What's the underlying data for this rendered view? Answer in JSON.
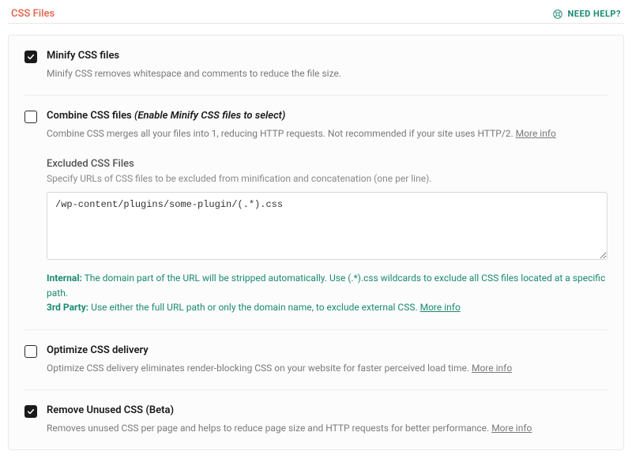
{
  "header": {
    "title": "CSS Files",
    "help_label": "NEED HELP?"
  },
  "options": {
    "minify": {
      "checked": true,
      "label": "Minify CSS files",
      "desc": "Minify CSS removes whitespace and comments to reduce the file size."
    },
    "combine": {
      "checked": false,
      "label": "Combine CSS files",
      "suffix": "(Enable Minify CSS files to select)",
      "desc": "Combine CSS merges all your files into 1, reducing HTTP requests. Not recommended if your site uses HTTP/2.",
      "more_info": "More info",
      "excluded": {
        "title": "Excluded CSS Files",
        "desc": "Specify URLs of CSS files to be excluded from minification and concatenation (one per line).",
        "value": "/wp-content/plugins/some-plugin/(.*).css",
        "hint_internal_label": "Internal:",
        "hint_internal_text": "The domain part of the URL will be stripped automatically. Use (.*).css wildcards to exclude all CSS files located at a specific path.",
        "hint_3rd_label": "3rd Party:",
        "hint_3rd_text": "Use either the full URL path or only the domain name, to exclude external CSS.",
        "hint_more_info": "More info"
      }
    },
    "optimize_delivery": {
      "checked": false,
      "label": "Optimize CSS delivery",
      "desc": "Optimize CSS delivery eliminates render-blocking CSS on your website for faster perceived load time.",
      "more_info": "More info"
    },
    "remove_unused": {
      "checked": true,
      "label": "Remove Unused CSS (Beta)",
      "desc": "Removes unused CSS per page and helps to reduce page size and HTTP requests for better performance.",
      "more_info": "More info"
    }
  }
}
